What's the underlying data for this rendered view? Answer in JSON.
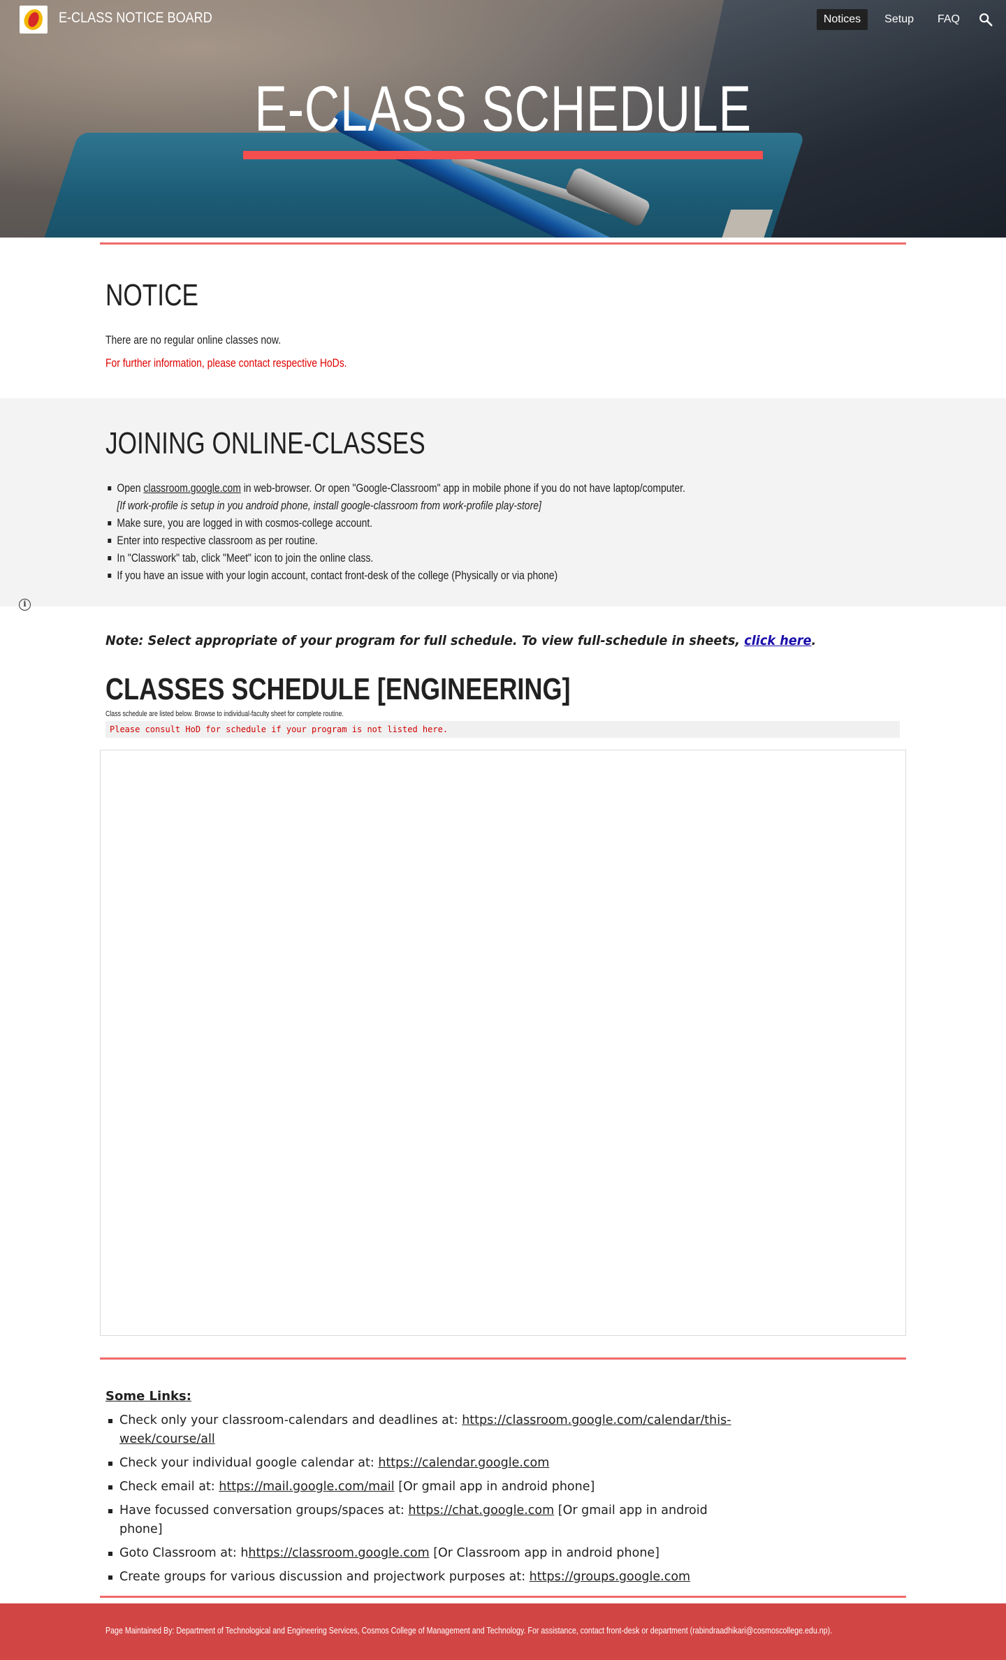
{
  "header": {
    "site_title": "E-CLASS NOTICE BOARD",
    "nav": [
      {
        "label": "Notices",
        "active": true
      },
      {
        "label": "Setup",
        "active": false
      },
      {
        "label": "FAQ",
        "active": false
      }
    ],
    "search_icon": "search-icon",
    "logo_icon": "college-logo"
  },
  "hero": {
    "title": "E-CLASS SCHEDULE",
    "accent_color": "#f44e4e"
  },
  "notice": {
    "heading": "NOTICE",
    "line1": "There are no regular online classes now.",
    "line2": "For further information, please contact respective HoDs.",
    "line2_color": "#e00000"
  },
  "joining": {
    "heading": "JOINING ONLINE-CLASSES",
    "items": [
      {
        "before": "Open ",
        "link": "classroom.google.com",
        "after": " in web-browser. Or open \"Google-Classroom\" app in mobile phone if you do not have laptop/computer.",
        "sub": "[If work-profile is setup in you android phone, install google-classroom from work-profile play-store]"
      },
      {
        "text": "Make sure, you are logged in with cosmos-college account."
      },
      {
        "text": "Enter into respective classroom as per routine."
      },
      {
        "text": "In \"Classwork\" tab, click \"Meet\" icon to join the online class."
      },
      {
        "text": "If you have an issue with your login account, contact front-desk of the college (Physically or via phone)"
      }
    ]
  },
  "note": {
    "text": "Note: Select appropriate  of your program for full schedule. To view full-schedule in sheets, ",
    "link": "click here",
    "end": "."
  },
  "schedule": {
    "heading": "CLASSES SCHEDULE [ENGINEERING]",
    "subtext": "Class schedule are listed below. Browse to individual-faculty sheet for complete routine.",
    "code_note": "Please consult HoD for schedule if your program is not listed here."
  },
  "links": {
    "heading": "Some Links:",
    "items": [
      {
        "before": "Check only your classroom-calendars and deadlines at: ",
        "link": "https://classroom.google.com/calendar/this-week/course/all",
        "after": ""
      },
      {
        "before": "Check your individual google calendar at: ",
        "link": "https://calendar.google.com",
        "after": ""
      },
      {
        "before": "Check email at: ",
        "link": "https://mail.google.com/mail",
        "after": " [Or gmail app in android phone]"
      },
      {
        "before": "Have focussed conversation groups/spaces at: ",
        "link": "https://chat.google.com",
        "after": " [Or gmail app in android phone]"
      },
      {
        "before": "Goto Classroom at: h",
        "link": "https://classroom.google.com",
        "after": " [Or Classroom app in android phone]"
      },
      {
        "before": "Create groups for various discussion and projectwork purposes at: ",
        "link": "https://groups.google.com",
        "after": ""
      }
    ]
  },
  "footer": {
    "text": "Page Maintained By: Department of Technological and Engineering Services, Cosmos College of Management and Technology. For assistance, contact front-desk or department (rabindraadhikari@cosmoscollege.edu.np).",
    "color": "#d24545"
  }
}
